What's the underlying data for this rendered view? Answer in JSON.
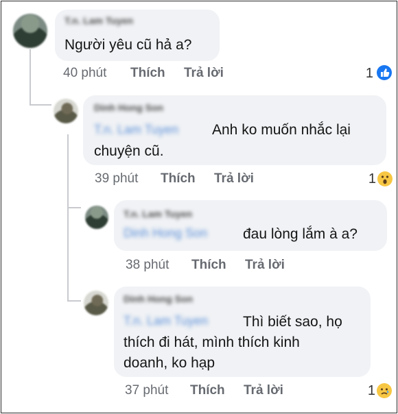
{
  "thread": {
    "c1": {
      "author": "T.n. Lam Tuyen",
      "text": "Người yêu cũ hả a?",
      "time": "40 phút",
      "like": "Thích",
      "reply": "Trả lời",
      "react_count": "1",
      "react_icon": "like-icon"
    },
    "c2": {
      "author": "Dinh Hong Son",
      "tag": "T.n. Lam Tuyen",
      "text_line1": "Anh ko muốn nhắc lại",
      "text_line2": "chuyện cũ.",
      "time": "39 phút",
      "like": "Thích",
      "reply": "Trả lời",
      "react_count": "1",
      "react_icon": "wow-icon"
    },
    "c3": {
      "author": "T.n. Lam Tuyen",
      "tag": "Dinh Hong Son",
      "text": "đau lòng lắm à a?",
      "time": "38 phút",
      "like": "Thích",
      "reply": "Trả lời"
    },
    "c4": {
      "author": "Dinh Hong Son",
      "tag": "T.n. Lam Tuyen",
      "text_line1": "Thì biết sao, họ",
      "text_line2": "thích đi hát, mình thích kinh",
      "text_line3": "doanh, ko hạp",
      "time": "37 phút",
      "like": "Thích",
      "reply": "Trả lời",
      "react_count": "1",
      "react_icon": "sad-icon"
    }
  },
  "colors": {
    "link": "#1877f2",
    "bubble": "#f0f2f5",
    "muted": "#666a70"
  }
}
